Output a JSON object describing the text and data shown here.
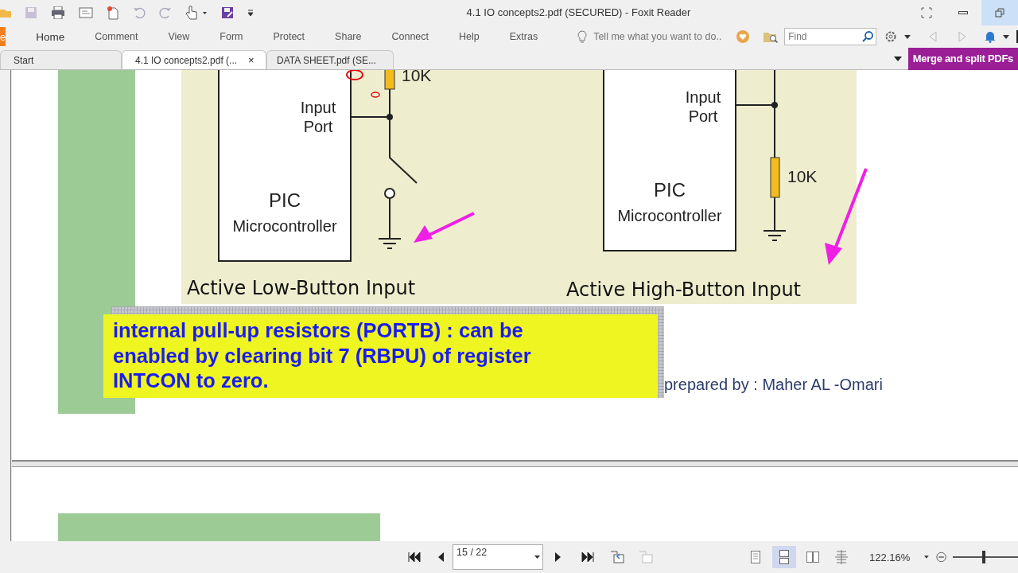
{
  "window": {
    "title": "4.1 IO concepts2.pdf (SECURED) - Foxit Reader"
  },
  "ribbon": {
    "file_tab": "e",
    "menus": [
      {
        "label": "Home",
        "selected": true
      },
      {
        "label": "Comment",
        "selected": false
      },
      {
        "label": "View",
        "selected": false
      },
      {
        "label": "Form",
        "selected": false
      },
      {
        "label": "Protect",
        "selected": false
      },
      {
        "label": "Share",
        "selected": false
      },
      {
        "label": "Connect",
        "selected": false
      },
      {
        "label": "Help",
        "selected": false
      },
      {
        "label": "Extras",
        "selected": false
      }
    ],
    "tell_me": {
      "placeholder": "Tell me what you want to do.."
    },
    "find": {
      "placeholder": "Find"
    }
  },
  "doc_tabs": [
    {
      "label": "Start",
      "selected": false
    },
    {
      "label": "4.1 IO concepts2.pdf (...",
      "selected": true,
      "close": "×"
    },
    {
      "label": "DATA SHEET.pdf (SE...",
      "selected": false
    }
  ],
  "merge_banner": "Merge and split PDFs",
  "diagram": {
    "circuits": [
      {
        "kind": "active_low",
        "port_lines": [
          "Input",
          "Port"
        ],
        "chip_lines": [
          "PIC",
          "Microcontroller"
        ],
        "resistor": "10K",
        "caption": "Active Low-Button Input"
      },
      {
        "kind": "active_high",
        "port_lines": [
          "Input",
          "Port"
        ],
        "chip_lines": [
          "PIC",
          "Microcontroller"
        ],
        "resistor": "10K",
        "caption": "Active High-Button Input"
      }
    ]
  },
  "note": {
    "lines": [
      "internal pull-up resistors (PORTB) : can be",
      "enabled by clearing bit 7 (RBPU) of register",
      "INTCON to zero."
    ]
  },
  "footer": "prepared by : Maher AL -Omari",
  "status_bar": {
    "page_field": {
      "value": "15 / 22"
    },
    "view_modes": [
      {
        "selected": false
      },
      {
        "selected": true
      },
      {
        "selected": false
      },
      {
        "selected": false
      }
    ],
    "zoom": "122.16%",
    "zoom_slider": {
      "level": 0.47
    }
  }
}
